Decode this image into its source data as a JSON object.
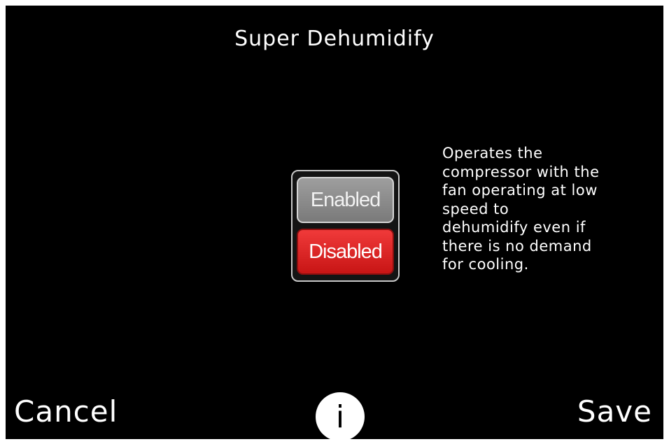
{
  "header": {
    "title": "Super Dehumidify"
  },
  "setting": {
    "options": [
      {
        "label": "Enabled",
        "selected": false
      },
      {
        "label": "Disabled",
        "selected": true
      }
    ],
    "selected_color": "#e82a2a",
    "unselected_color": "#8c8c8c"
  },
  "description": {
    "lines": [
      "Operates the",
      "compressor with the",
      "fan operating at low",
      "speed to",
      "dehumidify even if",
      "there is no demand",
      "for cooling."
    ]
  },
  "footer": {
    "cancel_label": "Cancel",
    "info_label": "i",
    "info_icon": "info-icon",
    "save_label": "Save"
  }
}
